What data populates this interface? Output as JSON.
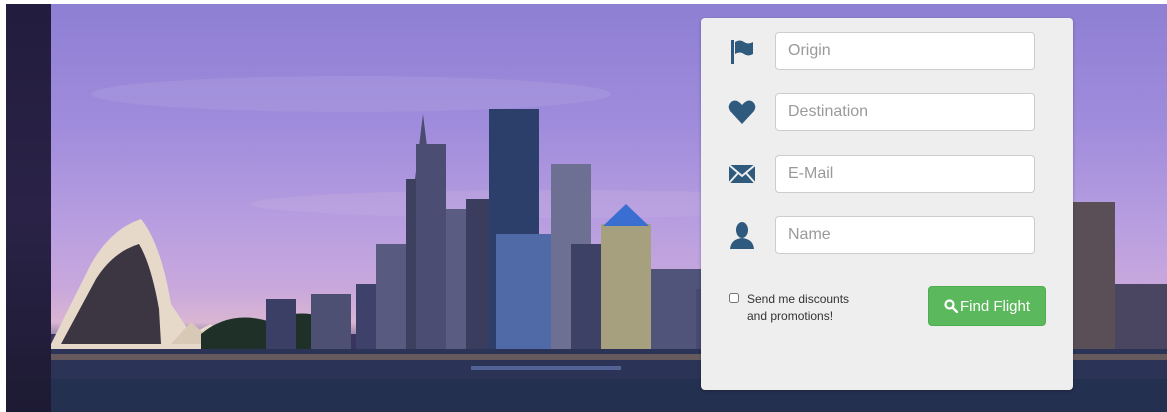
{
  "form": {
    "origin": {
      "placeholder": "Origin",
      "value": "",
      "icon": "flag-icon"
    },
    "destination": {
      "placeholder": "Destination",
      "value": "",
      "icon": "heart-icon"
    },
    "email": {
      "placeholder": "E-Mail",
      "value": "",
      "icon": "envelope-icon"
    },
    "name": {
      "placeholder": "Name",
      "value": "",
      "icon": "user-icon"
    },
    "promo_label_line1": "Send me discounts",
    "promo_label_line2": "and promotions!",
    "promo_checked": false,
    "submit_label": "Find Flight",
    "submit_icon": "search-icon"
  },
  "colors": {
    "icon": "#2f5a7e",
    "button": "#5cb85c",
    "panel": "#eeeeee"
  }
}
